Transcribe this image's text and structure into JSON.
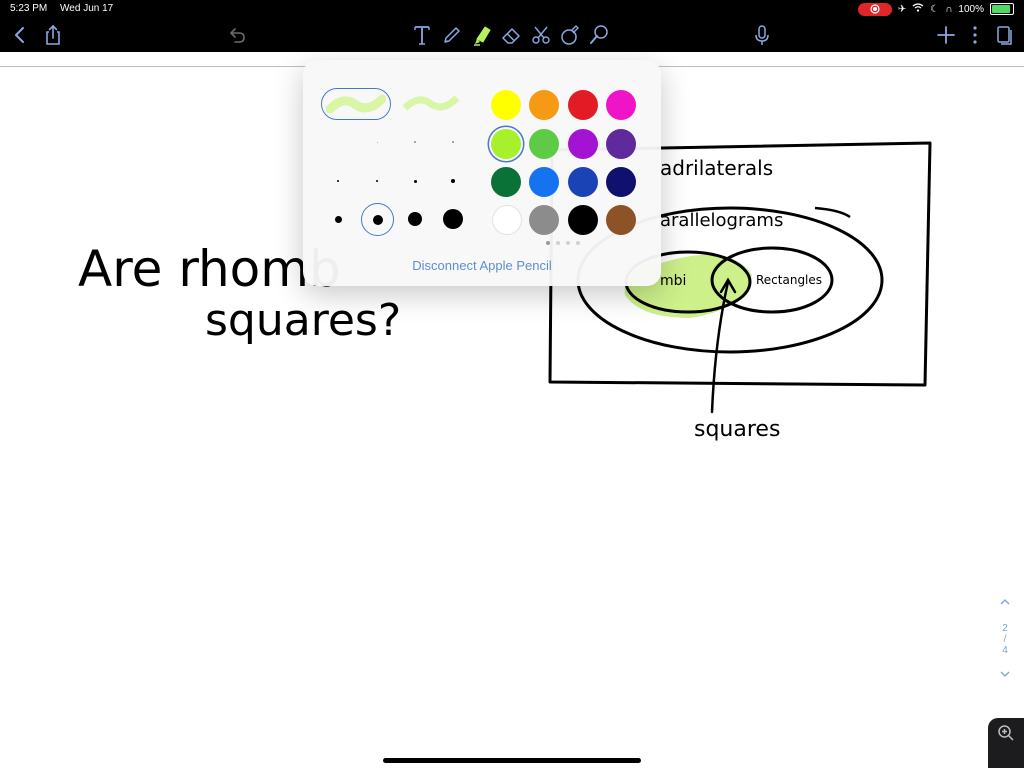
{
  "status_bar": {
    "time": "5:23 PM",
    "date": "Wed Jun 17",
    "battery": "100%"
  },
  "toolbar": {
    "left_icons": [
      "back-chevron-icon",
      "share-icon",
      "undo-icon"
    ],
    "center_tools": [
      "text-tool-icon",
      "pen-tool-icon",
      "highlighter-tool-icon",
      "eraser-tool-icon",
      "scissors-lasso-icon",
      "shapes-tool-icon",
      "lasso-tool-icon"
    ],
    "right_icons": [
      "microphone-icon",
      "add-page-icon",
      "more-icon",
      "pages-icon"
    ]
  },
  "popover": {
    "pen_styles": [
      "highlighter-style-1",
      "highlighter-style-2"
    ],
    "selected_style": 0,
    "selected_size": 9,
    "colors": [
      "#ffff00",
      "#f59a14",
      "#e21b24",
      "#f014c8",
      "#a6f02c",
      "#5fca45",
      "#a213d2",
      "#5e2a9c",
      "#0a7236",
      "#1573f0",
      "#1a44b6",
      "#10106e",
      "#ffffff",
      "#8c8c8c",
      "#000000",
      "#8d5327"
    ],
    "selected_color": "#a6f02c",
    "disconnect_label": "Disconnect Apple Pencil"
  },
  "canvas": {
    "question_line1": "Are rhomb",
    "question_line2": "squares?",
    "outer_label": "adrilaterals",
    "middle_label": "arallelograms",
    "left_circle_label": "mbi",
    "right_circle_label": "Rectangles",
    "arrow_label": "squares",
    "highlight_color": "#cdf08a"
  },
  "page_nav": {
    "current": "2",
    "separator": "/",
    "total": "4"
  }
}
